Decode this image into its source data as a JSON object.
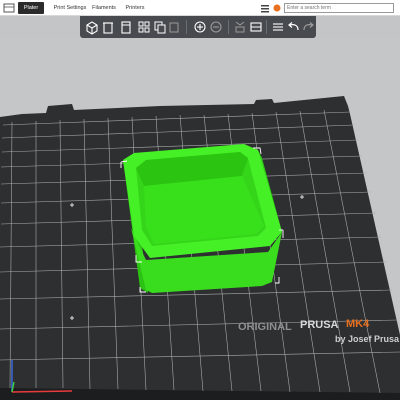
{
  "tabs": [
    {
      "label": "Plater",
      "active": true
    },
    {
      "label": "Print Settings",
      "active": false
    },
    {
      "label": "Filaments",
      "active": false
    },
    {
      "label": "Printers",
      "active": false
    }
  ],
  "search": {
    "placeholder": "Enter a search term"
  },
  "toolbar": {
    "tools": [
      "add-box-icon",
      "delete-icon",
      "delete-all-icon",
      "arrange-icon",
      "copy-icon",
      "paste-icon",
      "add-instance-icon",
      "remove-instance-icon",
      "split-objects-icon",
      "split-parts-icon",
      "layers-editing-icon",
      "undo-icon",
      "redo-icon"
    ]
  },
  "bed": {
    "brand_text_1": "ORIGINAL",
    "brand_text_2": "PRUSA",
    "brand_text_3": "MK4",
    "brand_text_4": "by Josef Prusa"
  },
  "colors": {
    "model": "#35e81a",
    "bed": "#2e2f31",
    "grid": "#b0b0b0",
    "brand_accent": "#e8701f"
  }
}
